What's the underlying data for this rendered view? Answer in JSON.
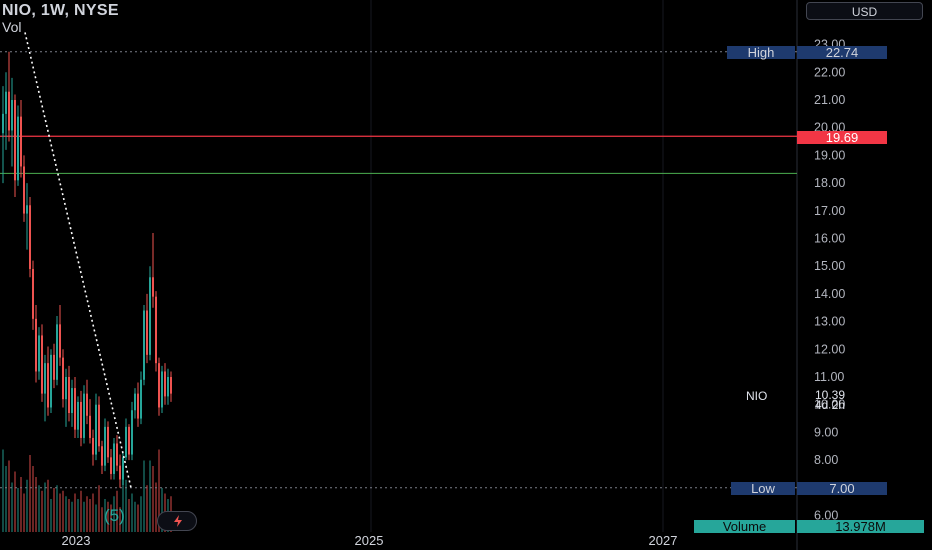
{
  "header": {
    "title": "NIO, 1W, NYSE",
    "indicator": "Vol"
  },
  "currency_button": {
    "label": "USD"
  },
  "markers": {
    "high": {
      "label": "High",
      "value": "22.74"
    },
    "low": {
      "label": "Low",
      "value": "7.00"
    },
    "current": {
      "symbol": "NIO",
      "price": "10.39",
      "countdown": "4d 2h"
    },
    "resistance": {
      "value": "19.69"
    },
    "volume": {
      "label": "Volume",
      "value": "13.978M"
    }
  },
  "badge": {
    "text": "(5)"
  },
  "colors": {
    "up": "#26a69a",
    "down": "#ef5350",
    "marker": "#1e3a6e",
    "resistance": "#f23645",
    "support": "#4caf50",
    "volume_tag": "#26a69a"
  },
  "icons": {
    "bolt": "lightning-bolt-icon"
  },
  "chart_data": {
    "type": "candlestick",
    "title": "NIO, 1W, NYSE",
    "ylim": [
      5.6,
      23.2
    ],
    "y_ticks": [
      "6.00",
      "7.00",
      "8.00",
      "9.00",
      "10.00",
      "11.00",
      "12.00",
      "13.00",
      "14.00",
      "15.00",
      "16.00",
      "17.00",
      "18.00",
      "19.00",
      "20.00",
      "21.00",
      "22.00",
      "23.00"
    ],
    "x_ticks": [
      "2023",
      "2025",
      "2027"
    ],
    "horizontal_lines": [
      {
        "label": "resistance",
        "value": 19.69
      },
      {
        "label": "support",
        "value": 18.35
      },
      {
        "label": "high",
        "value": 22.74
      },
      {
        "label": "low",
        "value": 7.0
      }
    ],
    "trendline": {
      "from": [
        0,
        23.8
      ],
      "to": [
        41,
        7.0
      ]
    },
    "series": [
      {
        "values": [
          [
            19.8,
            21.5,
            18.0,
            20.5
          ],
          [
            20.5,
            22.0,
            19.2,
            21.3
          ],
          [
            21.3,
            22.74,
            19.5,
            19.9
          ],
          [
            19.9,
            21.8,
            18.6,
            21.0
          ],
          [
            21.0,
            21.2,
            17.5,
            18.1
          ],
          [
            18.1,
            20.8,
            17.9,
            20.4
          ],
          [
            20.4,
            21.0,
            18.2,
            18.6
          ],
          [
            18.6,
            19.0,
            16.6,
            16.9
          ],
          [
            16.9,
            18.0,
            15.6,
            17.2
          ],
          [
            17.2,
            17.5,
            14.6,
            14.9
          ],
          [
            14.9,
            15.2,
            12.7,
            13.1
          ],
          [
            13.1,
            13.6,
            10.8,
            11.2
          ],
          [
            11.2,
            12.8,
            10.9,
            12.5
          ],
          [
            12.5,
            12.9,
            10.1,
            10.4
          ],
          [
            10.4,
            11.8,
            9.4,
            11.5
          ],
          [
            11.5,
            12.1,
            9.6,
            9.9
          ],
          [
            9.9,
            12.0,
            9.7,
            11.8
          ],
          [
            11.8,
            12.2,
            10.6,
            10.9
          ],
          [
            10.9,
            13.2,
            10.7,
            12.9
          ],
          [
            12.9,
            13.6,
            11.4,
            11.7
          ],
          [
            11.7,
            12.0,
            9.9,
            10.2
          ],
          [
            10.2,
            11.3,
            9.2,
            11.0
          ],
          [
            11.0,
            11.4,
            9.4,
            9.7
          ],
          [
            9.7,
            10.9,
            9.2,
            10.6
          ],
          [
            10.6,
            11.0,
            8.8,
            9.1
          ],
          [
            9.1,
            10.3,
            8.8,
            10.1
          ],
          [
            10.1,
            10.5,
            8.5,
            8.8
          ],
          [
            8.8,
            10.7,
            8.6,
            10.4
          ],
          [
            10.4,
            10.9,
            9.3,
            9.6
          ],
          [
            9.6,
            10.2,
            8.6,
            8.8
          ],
          [
            8.8,
            9.1,
            7.8,
            8.2
          ],
          [
            8.2,
            10.4,
            8.0,
            10.0
          ],
          [
            10.0,
            10.3,
            8.3,
            8.5
          ],
          [
            8.5,
            8.7,
            7.5,
            7.8
          ],
          [
            7.8,
            9.5,
            7.6,
            9.2
          ],
          [
            9.2,
            9.4,
            7.9,
            8.1
          ],
          [
            8.1,
            8.4,
            7.3,
            7.5
          ],
          [
            7.5,
            8.8,
            7.3,
            8.6
          ],
          [
            8.6,
            8.9,
            7.6,
            7.8
          ],
          [
            7.8,
            8.2,
            7.0,
            7.3
          ],
          [
            7.3,
            8.3,
            7.1,
            8.1
          ],
          [
            8.1,
            9.5,
            8.0,
            9.2
          ],
          [
            9.2,
            9.3,
            8.0,
            8.2
          ],
          [
            8.2,
            10.1,
            8.0,
            9.8
          ],
          [
            9.8,
            10.6,
            9.5,
            10.4
          ],
          [
            10.4,
            10.8,
            9.2,
            9.5
          ],
          [
            9.5,
            11.2,
            9.3,
            10.9
          ],
          [
            10.9,
            13.6,
            10.7,
            13.4
          ],
          [
            13.4,
            14.0,
            11.5,
            11.8
          ],
          [
            11.8,
            15.0,
            11.6,
            14.6
          ],
          [
            14.6,
            16.2,
            13.5,
            13.9
          ],
          [
            13.9,
            14.1,
            11.2,
            11.5
          ],
          [
            11.5,
            11.7,
            9.6,
            9.9
          ],
          [
            9.9,
            11.4,
            9.7,
            11.2
          ],
          [
            11.2,
            11.5,
            10.0,
            10.3
          ],
          [
            10.3,
            11.3,
            10.0,
            11.0
          ],
          [
            11.0,
            11.2,
            10.1,
            10.4
          ]
        ]
      }
    ],
    "volume": [
      150,
      120,
      130,
      90,
      110,
      80,
      100,
      70,
      95,
      140,
      120,
      100,
      85,
      75,
      90,
      95,
      60,
      80,
      85,
      70,
      75,
      65,
      60,
      55,
      70,
      60,
      75,
      55,
      65,
      60,
      70,
      50,
      85,
      45,
      60,
      55,
      50,
      65,
      75,
      45,
      120,
      95,
      60,
      70,
      55,
      50,
      65,
      130,
      85,
      130,
      120,
      90,
      150,
      80,
      70,
      60,
      65
    ]
  }
}
